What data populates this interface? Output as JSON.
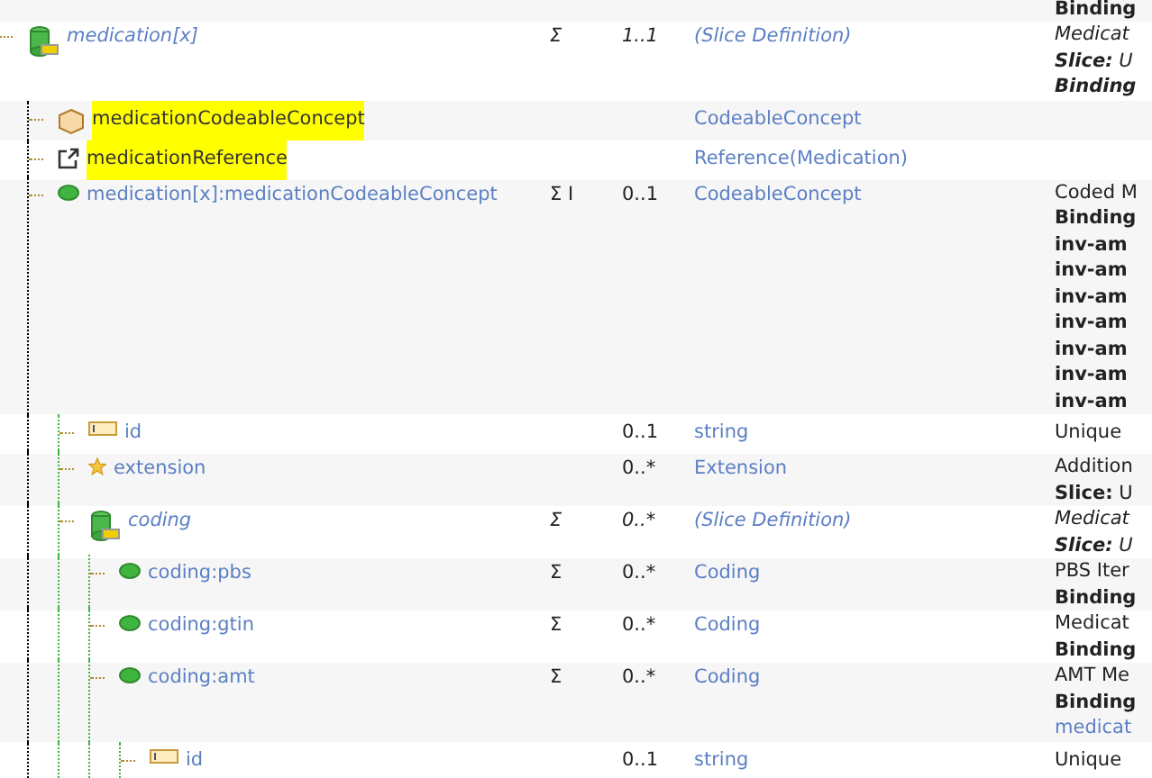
{
  "rows": [
    {
      "kind": "none",
      "desc": [
        {
          "text": "Binding",
          "kind": "bold"
        }
      ]
    },
    {
      "name": "medication[x]",
      "kind": "slice",
      "flags": "Σ",
      "card": "1..1",
      "type": "(Slice Definition)",
      "slice": true,
      "highlighted": false,
      "desc": [
        {
          "text": "Medicat"
        },
        {
          "text": "**Slice:** U"
        },
        {
          "text": "Binding",
          "kind": "bold"
        }
      ],
      "children": [
        {
          "name": "medicationCodeableConcept",
          "kind": "datatype",
          "type": "CodeableConcept",
          "slice": false,
          "highlighted": true
        },
        {
          "name": "medicationReference",
          "kind": "reference",
          "type": "Reference(Medication)",
          "slice": false,
          "highlighted": true
        },
        {
          "name": "medication[x]:medicationCodeableConcept",
          "kind": "element",
          "flags": "Σ I",
          "card": "0..1",
          "type": "CodeableConcept",
          "slice": false,
          "highlighted": false,
          "desc": [
            {
              "text": "Coded M"
            },
            {
              "text": "Binding",
              "kind": "bold"
            },
            {
              "text": "inv-am",
              "kind": "bold"
            },
            {
              "text": "inv-am",
              "kind": "bold"
            },
            {
              "text": "inv-am",
              "kind": "bold"
            },
            {
              "text": "inv-am",
              "kind": "bold"
            },
            {
              "text": "inv-am",
              "kind": "bold"
            },
            {
              "text": "inv-am",
              "kind": "bold"
            },
            {
              "text": "inv-am",
              "kind": "bold"
            }
          ],
          "children": [
            {
              "name": "id",
              "kind": "primitive",
              "card": "0..1",
              "type": "string",
              "slice": false,
              "highlighted": false,
              "desc": [
                {
                  "text": "Unique"
                }
              ]
            },
            {
              "name": "extension",
              "kind": "extension",
              "card": "0..*",
              "type": "Extension",
              "slice": false,
              "highlighted": false,
              "desc": [
                {
                  "text": "Addition"
                },
                {
                  "text": "**Slice:** U"
                }
              ]
            },
            {
              "name": "coding",
              "kind": "slice",
              "flags": "Σ",
              "card": "0..*",
              "type": "(Slice Definition)",
              "slice": true,
              "highlighted": false,
              "desc": [
                {
                  "text": "Medicat"
                },
                {
                  "text": "**Slice:** U"
                }
              ],
              "children": [
                {
                  "name": "coding:pbs",
                  "kind": "element",
                  "flags": "Σ",
                  "card": "0..*",
                  "type": "Coding",
                  "slice": false,
                  "highlighted": false,
                  "desc": [
                    {
                      "text": "PBS Iter"
                    },
                    {
                      "text": "Binding",
                      "kind": "bold"
                    }
                  ]
                },
                {
                  "name": "coding:gtin",
                  "kind": "element",
                  "flags": "Σ",
                  "card": "0..*",
                  "type": "Coding",
                  "slice": false,
                  "highlighted": false,
                  "desc": [
                    {
                      "text": "Medicat"
                    },
                    {
                      "text": "Binding",
                      "kind": "bold"
                    }
                  ]
                },
                {
                  "name": "coding:amt",
                  "kind": "element",
                  "flags": "Σ",
                  "card": "0..*",
                  "type": "Coding",
                  "slice": false,
                  "highlighted": false,
                  "desc": [
                    {
                      "text": "AMT Me"
                    },
                    {
                      "text": "Binding",
                      "kind": "bold"
                    },
                    {
                      "text": "medicat",
                      "kind": "link"
                    }
                  ],
                  "children": [
                    {
                      "name": "id",
                      "kind": "primitive",
                      "card": "0..1",
                      "type": "string",
                      "slice": false,
                      "highlighted": false,
                      "desc": [
                        {
                          "text": "Unique"
                        }
                      ]
                    }
                  ]
                }
              ]
            }
          ]
        }
      ]
    }
  ]
}
